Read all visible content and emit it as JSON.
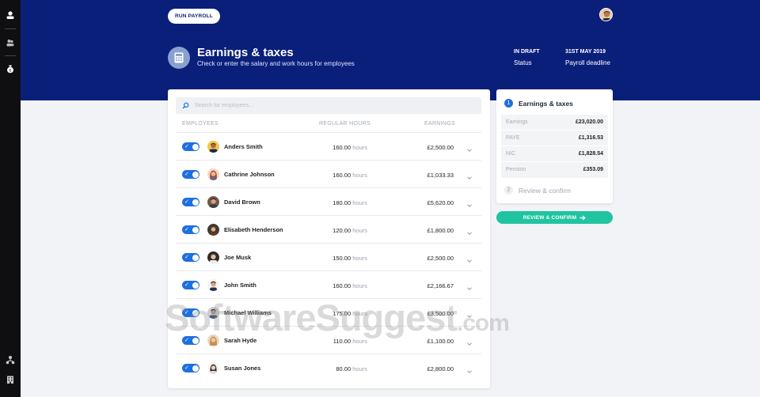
{
  "toolbar": {
    "run_payroll": "RUN PAYROLL"
  },
  "page": {
    "title": "Earnings & taxes",
    "subtitle": "Check or enter the salary and work hours for employees",
    "status_value": "IN DRAFT",
    "status_label": "Status",
    "deadline_value": "31ST MAY 2019",
    "deadline_label": "Payroll deadline"
  },
  "table": {
    "search_placeholder": "Search for employees...",
    "headers": {
      "employees": "EMPLOYEES",
      "hours": "REGULAR HOURS",
      "earnings": "EARNINGS"
    },
    "hours_unit": "hours",
    "rows": [
      {
        "name": "Anders Smith",
        "hours": "160.00",
        "earnings": "£2,500.00"
      },
      {
        "name": "Cathrine Johnson",
        "hours": "160.00",
        "earnings": "£1,033.33"
      },
      {
        "name": "David Brown",
        "hours": "180.00",
        "earnings": "£5,620.00"
      },
      {
        "name": "Elisabeth Henderson",
        "hours": "120.00",
        "earnings": "£1,800.00"
      },
      {
        "name": "Joe Musk",
        "hours": "150.00",
        "earnings": "£2,500.00"
      },
      {
        "name": "John Smith",
        "hours": "160.00",
        "earnings": "£2,166.67"
      },
      {
        "name": "Michael Williams",
        "hours": "175.00",
        "earnings": "£3,500.00"
      },
      {
        "name": "Sarah Hyde",
        "hours": "110.00",
        "earnings": "£1,100.00"
      },
      {
        "name": "Susan Jones",
        "hours": "80.00",
        "earnings": "£2,800.00"
      }
    ]
  },
  "summary": {
    "step1_number": "1",
    "step1_label": "Earnings & taxes",
    "items": [
      {
        "label": "Earnings",
        "value": "£23,020.00"
      },
      {
        "label": "PAYE",
        "value": "£1,316.53"
      },
      {
        "label": "NIC",
        "value": "£1,828.54"
      },
      {
        "label": "Pension",
        "value": "£353.09"
      }
    ],
    "step2_number": "2",
    "step2_label": "Review & confirm",
    "confirm_button": "REVIEW & CONFIRM"
  },
  "watermark": {
    "main": "SoftwareSuggest",
    "suffix": ".com"
  },
  "colors": {
    "header": "#0a1f7a",
    "accent": "#1e6fe0",
    "confirm": "#20c4a0"
  }
}
